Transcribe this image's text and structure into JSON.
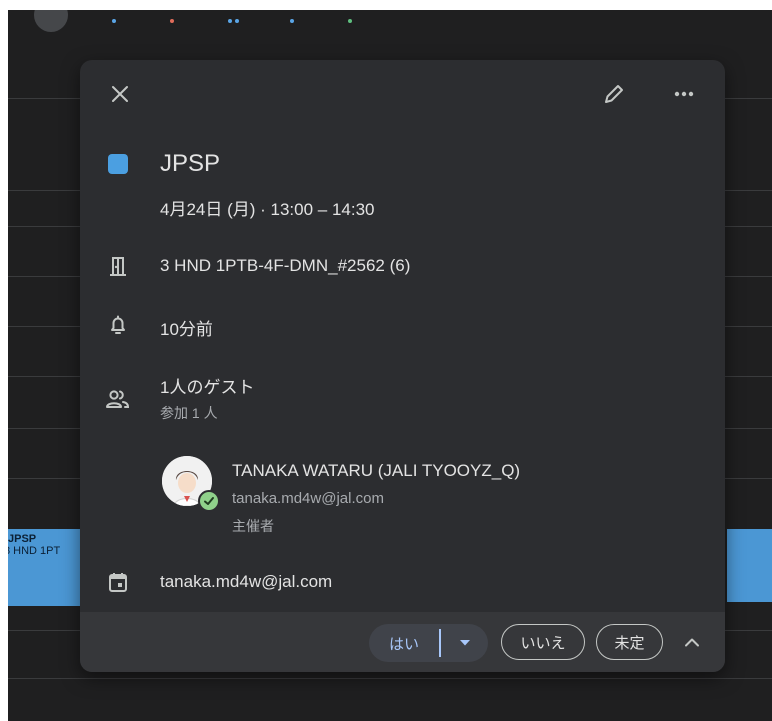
{
  "event": {
    "title": "JPSP",
    "datetime": "4月24日 (月) · 13:00 – 14:30",
    "color": "#4b9fe1",
    "room": "3 HND 1PTB-4F-DMN_#2562 (6)",
    "notification": "10分前",
    "guests_summary": "1人のゲスト",
    "guests_sub": "参加 1 人",
    "organizer": {
      "name": "TANAKA WATARU (JALI TYOOYZ_Q)",
      "email": "tanaka.md4w@jal.com",
      "role": "主催者"
    },
    "calendar": "tanaka.md4w@jal.com"
  },
  "rsvp": {
    "yes": "はい",
    "no": "いいえ",
    "maybe": "未定"
  },
  "background_event": {
    "title": "JPSP",
    "location": "3 HND 1PT"
  },
  "icons": {
    "close": "close-icon",
    "edit": "pencil-icon",
    "more": "more-options-icon",
    "room": "door-icon",
    "notification": "bell-icon",
    "guests": "people-icon",
    "calendar": "calendar-icon",
    "rsvp_dropdown": "caret-down-icon",
    "collapse": "chevron-up-icon"
  }
}
